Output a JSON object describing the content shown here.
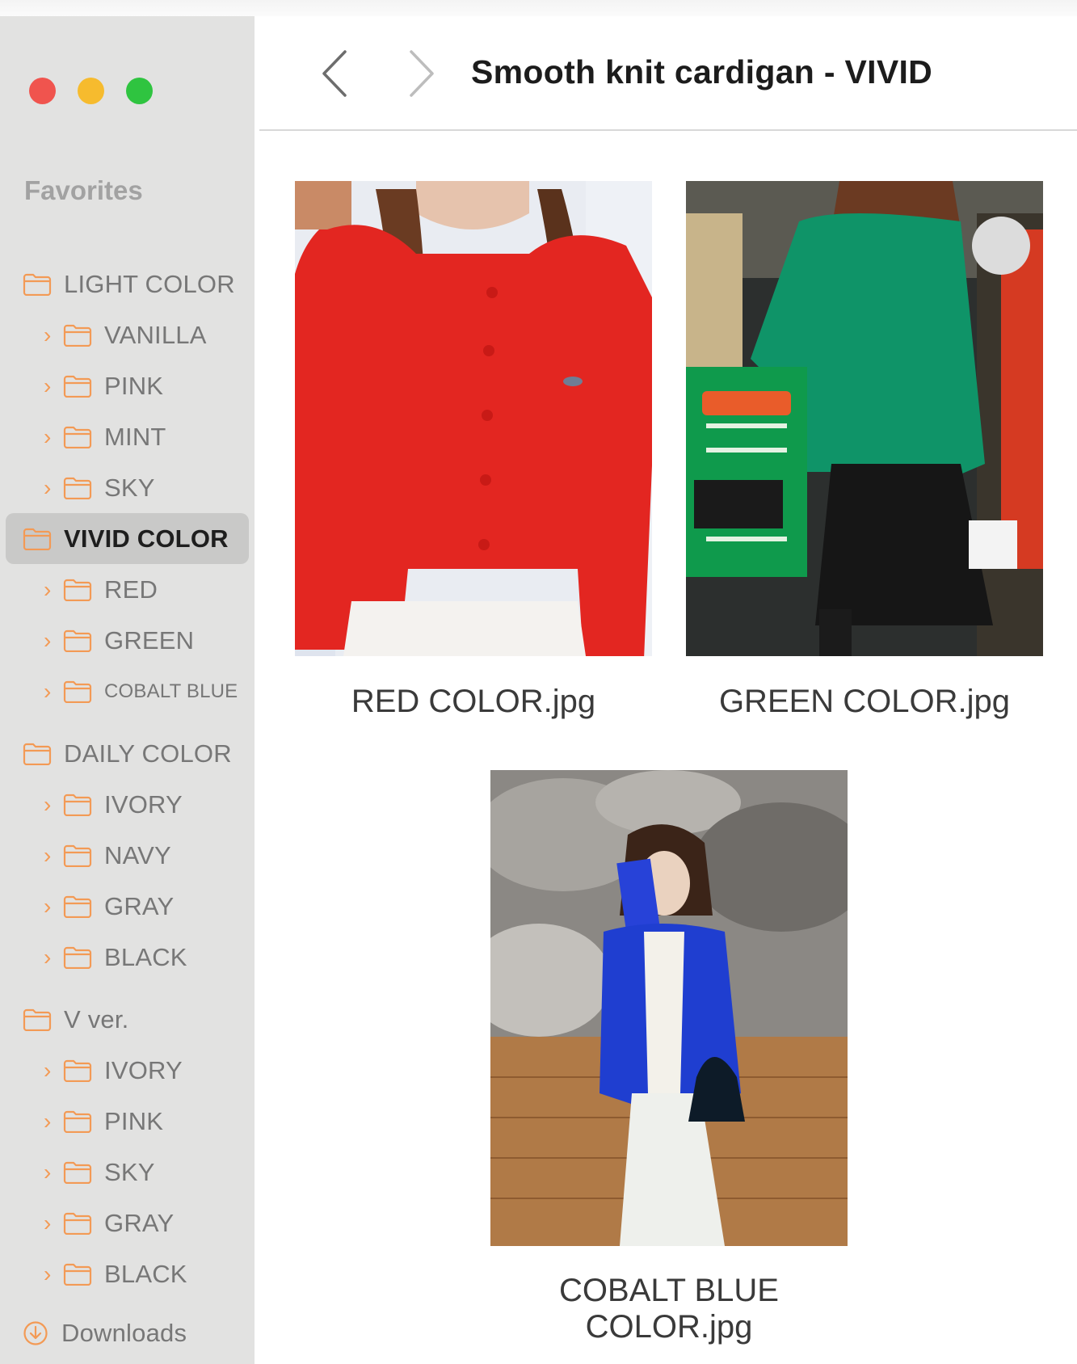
{
  "window": {
    "title": "Smooth knit cardigan - VIVID"
  },
  "sidebar": {
    "favorites_label": "Favorites",
    "groups": [
      {
        "label": "LIGHT COLOR",
        "children": [
          "VANILLA",
          "PINK",
          "MINT",
          "SKY"
        ]
      },
      {
        "label": "VIVID COLOR",
        "selected": true,
        "children": [
          "RED",
          "GREEN",
          "COBALT BLUE"
        ]
      },
      {
        "label": "DAILY COLOR",
        "children": [
          "IVORY",
          "NAVY",
          "GRAY",
          "BLACK"
        ]
      },
      {
        "label": "V ver.",
        "children": [
          "IVORY",
          "PINK",
          "SKY",
          "GRAY",
          "BLACK"
        ]
      }
    ],
    "downloads_label": "Downloads"
  },
  "files": [
    {
      "name": "RED COLOR.jpg",
      "garment_color": "#e32621"
    },
    {
      "name": "GREEN COLOR.jpg",
      "garment_color": "#0f9468"
    },
    {
      "name": "COBALT BLUE COLOR.jpg",
      "garment_color": "#1f3ed0"
    }
  ],
  "icons": {
    "folder": "folder-icon",
    "chevron": "chevron-right-icon",
    "downloads": "download-circle-icon",
    "back": "chevron-left-icon",
    "forward": "chevron-right-icon"
  },
  "colors": {
    "accent": "#f39a55",
    "sidebar_bg": "#e2e2e1",
    "selected_bg": "#c9c9c8"
  }
}
